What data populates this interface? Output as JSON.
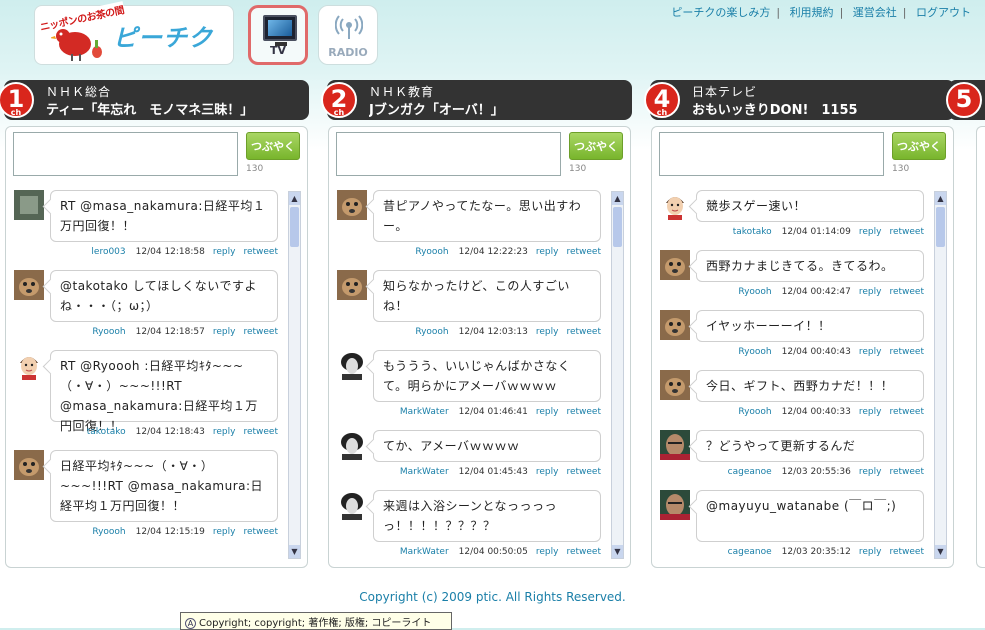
{
  "header": {
    "logo_tag": "ニッポンのお茶の間",
    "logo_text": "ピーチク",
    "tv_label": "TV",
    "radio_label": "RADIO",
    "links": [
      "ピーチクの楽しみ方",
      "利用規約",
      "運営会社",
      "ログアウト"
    ]
  },
  "composer": {
    "button_label": "つぶやく",
    "char_count": "130"
  },
  "channels": [
    {
      "number": "1",
      "ch": "ch",
      "name": "ＮＨＫ総合",
      "program": "ティー「年忘れ　モノマネ三昧！」",
      "tweets": [
        {
          "text": "RT @masa_nakamura:日経平均１万円回復！！",
          "user": "lero003",
          "time": "12/04 12:18:58",
          "avatar": "dark-photo"
        },
        {
          "text": "@takotako してほしくないですよね・・・（；ω；）",
          "user": "Ryoooh",
          "time": "12/04 12:18:57",
          "avatar": "dog"
        },
        {
          "text": "RT @Ryoooh :日経平均ｷﾀ~~~（・∀・）~~~!!!RT @masa_nakamura:日経平均１万円回復！！",
          "user": "takotako",
          "time": "12/04 12:18:43",
          "avatar": "mii"
        },
        {
          "text": "日経平均ｷﾀ~~~（・∀・）~~~!!!RT @masa_nakamura:日経平均１万円回復！！",
          "user": "Ryoooh",
          "time": "12/04 12:15:19",
          "avatar": "dog"
        }
      ]
    },
    {
      "number": "2",
      "ch": "ch",
      "name": "ＮＨＫ教育",
      "program": "Jブンガク「オーバ！」",
      "tweets": [
        {
          "text": "昔ピアノやってたなー。思い出すわー。",
          "user": "Ryoooh",
          "time": "12/04 12:22:23",
          "avatar": "dog"
        },
        {
          "text": "知らなかったけど、この人すごいね！",
          "user": "Ryoooh",
          "time": "12/04 12:03:13",
          "avatar": "dog"
        },
        {
          "text": "もううう、いいじゃんばかさなくて。明らかにアメーバｗｗｗｗ",
          "user": "MarkWater",
          "time": "12/04 01:46:41",
          "avatar": "portrait"
        },
        {
          "text": "てか、アメーバｗｗｗｗ",
          "user": "MarkWater",
          "time": "12/04 01:45:43",
          "avatar": "portrait"
        },
        {
          "text": "来週は入浴シーンとなっっっっっ！！！！？？？？",
          "user": "MarkWater",
          "time": "12/04 00:50:05",
          "avatar": "portrait"
        }
      ]
    },
    {
      "number": "4",
      "ch": "ch",
      "name": "日本テレビ",
      "program": "おもいッきりDON!　1155",
      "tweets": [
        {
          "text": "競歩スゲー速い！",
          "user": "takotako",
          "time": "12/04 01:14:09",
          "avatar": "mii"
        },
        {
          "text": "西野カナまじきてる。きてるわ。",
          "user": "Ryoooh",
          "time": "12/04 00:42:47",
          "avatar": "dog"
        },
        {
          "text": "イヤッホーーーイ！！",
          "user": "Ryoooh",
          "time": "12/04 00:40:43",
          "avatar": "dog"
        },
        {
          "text": "今日、ギフト、西野カナだ！！！",
          "user": "Ryoooh",
          "time": "12/04 00:40:33",
          "avatar": "dog"
        },
        {
          "text": "？どうやって更新するんだ",
          "user": "cageanoe",
          "time": "12/03 20:55:36",
          "avatar": "face"
        },
        {
          "text": "@mayuyu_watanabe (￣ロ￣;)",
          "user": "cageanoe",
          "time": "12/03 20:35:12",
          "avatar": "face"
        }
      ]
    }
  ],
  "next_channel_number": "5",
  "actions": {
    "reply": "reply",
    "retweet": "retweet"
  },
  "footer": "Copyright (c) 2009 ptic. All Rights Reserved.",
  "tooltip": "Copyright; copyright; 著作権; 版権; コピーライト",
  "colors": {
    "accent_red": "#d9261c",
    "link_blue": "#1a7fa8",
    "button_green": "#78b52c",
    "header_dark": "#333333"
  }
}
